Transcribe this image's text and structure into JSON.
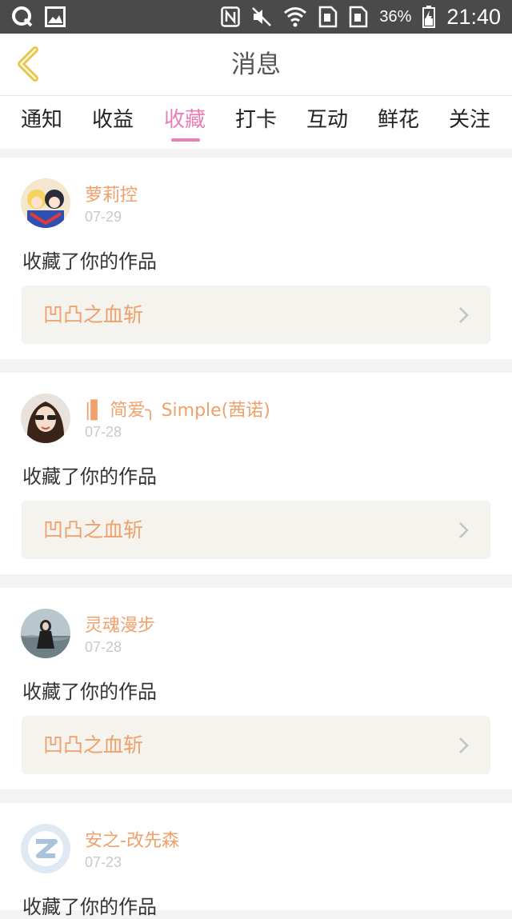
{
  "status_bar": {
    "battery": "36%",
    "time": "21:40"
  },
  "header": {
    "title": "消息"
  },
  "tabs": [
    {
      "label": "通知",
      "active": false
    },
    {
      "label": "收益",
      "active": false
    },
    {
      "label": "收藏",
      "active": true
    },
    {
      "label": "打卡",
      "active": false
    },
    {
      "label": "互动",
      "active": false
    },
    {
      "label": "鲜花",
      "active": false
    },
    {
      "label": "关注",
      "active": false
    }
  ],
  "notifications": [
    {
      "user": "萝莉控",
      "date": "07-29",
      "action": "收藏了你的作品",
      "work": "凹凸之血斩"
    },
    {
      "user": "|▌ 简爱╮ Simple(茜诺)",
      "date": "07-28",
      "action": "收藏了你的作品",
      "work": "凹凸之血斩"
    },
    {
      "user": "灵魂漫步",
      "date": "07-28",
      "action": "收藏了你的作品",
      "work": "凹凸之血斩"
    },
    {
      "user": "安之-改先森",
      "date": "07-23",
      "action": "收藏了你的作品",
      "work": ""
    }
  ],
  "colors": {
    "accent_pink": "#e97fb4",
    "accent_orange": "#f0a06a",
    "back_arrow": "#e8c54a"
  }
}
